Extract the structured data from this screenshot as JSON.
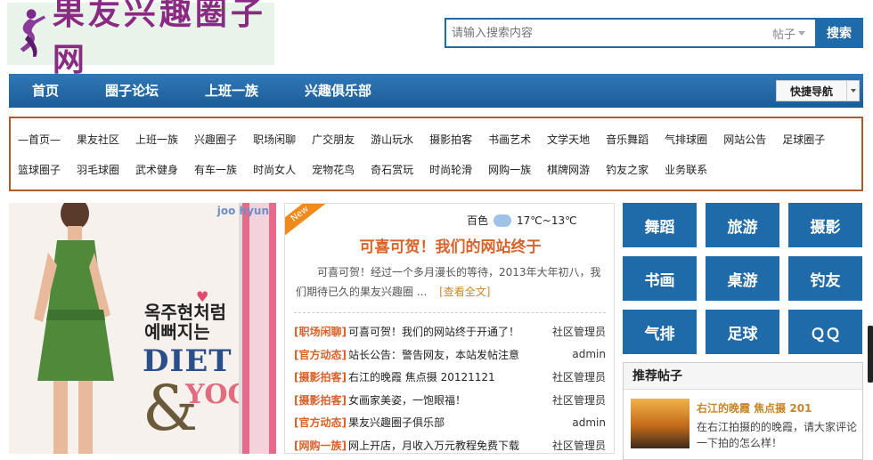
{
  "logo": {
    "text": "果友兴趣圈子网"
  },
  "search": {
    "placeholder": "请输入搜索内容",
    "scope": "帖子",
    "button": "搜索"
  },
  "nav": {
    "items": [
      "首页",
      "圈子论坛",
      "上班一族",
      "兴趣俱乐部"
    ],
    "quick_nav": "快捷导航"
  },
  "categories": {
    "row1": [
      "—首页—",
      "果友社区",
      "上班一族",
      "兴趣圈子",
      "职场闲聊",
      "广交朋友",
      "游山玩水",
      "摄影拍客",
      "书画艺术",
      "文学天地",
      "音乐舞蹈",
      "气排球圈",
      "网站公告",
      "足球圈子"
    ],
    "row2": [
      "篮球圈子",
      "羽毛球圈",
      "武术健身",
      "有车一族",
      "时尚女人",
      "宠物花鸟",
      "奇石赏玩",
      "时尚轮滑",
      "网购一族",
      "棋牌网游",
      "钓友之家",
      "业务联系"
    ]
  },
  "ad": {
    "korean_line1": "옥주현처럼",
    "korean_line2": "예뻐지는",
    "diet": "DIET",
    "amp": "&",
    "yoga": "YOGA",
    "corner": "joo hyun"
  },
  "feature": {
    "badge": "New",
    "weather_city": "百色",
    "weather_temp": "17℃~13℃",
    "headline": "可喜可贺！我们的网站终于",
    "summary": "可喜可贺！经过一个多月漫长的等待，2013年大年初八，我们期待已久的果友兴趣圈 ...",
    "more": "[查看全文]",
    "news": [
      {
        "tag": "[职场闲聊]",
        "title": "可喜可贺！我们的网站终于开通了！",
        "author": "社区管理员"
      },
      {
        "tag": "[官方动态]",
        "title": "站长公告：警告网友，本站发帖注意",
        "author": "admin"
      },
      {
        "tag": "[摄影拍客]",
        "title": "右江的晚霞 焦点摄 20121121",
        "author": "社区管理员"
      },
      {
        "tag": "[摄影拍客]",
        "title": "女画家美姿，一饱眼福！",
        "author": "社区管理员"
      },
      {
        "tag": "[官方动态]",
        "title": "果友兴趣圈子俱乐部",
        "author": "admin"
      },
      {
        "tag": "[网购一族]",
        "title": "网上开店，月收入万元教程免费下载",
        "author": "社区管理员"
      }
    ]
  },
  "tiles": [
    "舞蹈",
    "旅游",
    "摄影",
    "书画",
    "桌游",
    "钓友",
    "气排",
    "足球",
    "ＱＱ"
  ],
  "recommend": {
    "heading": "推荐帖子",
    "title": "右江的晚霞 焦点摄 201",
    "desc": "在右江拍摄的的晚霞，请大家评论一下拍的怎么样！"
  },
  "colors": {
    "brand_blue": "#1f6aa8",
    "accent_orange": "#d9622b",
    "border_brown": "#a65e2e"
  }
}
